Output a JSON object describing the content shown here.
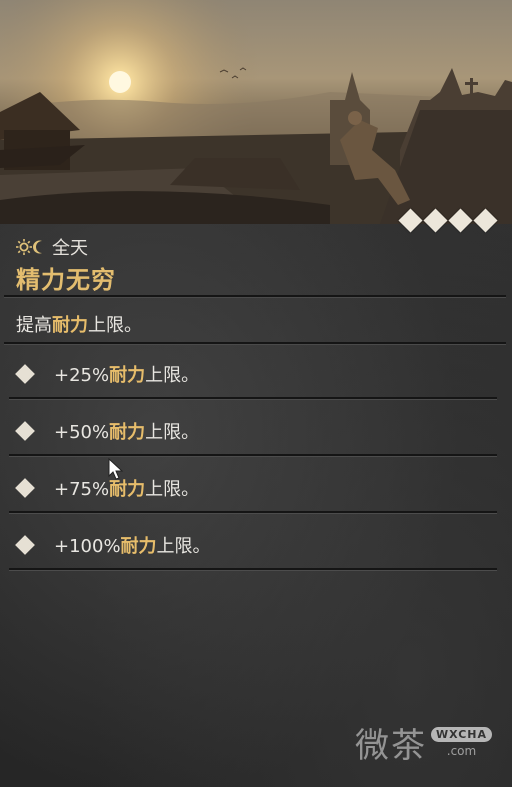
{
  "skill": {
    "time_label": "全天",
    "name": "精力无穷",
    "description_prefix": "提高",
    "description_highlight": "耐力",
    "description_suffix": "上限。",
    "rank_count": 4,
    "ranks": [
      {
        "value": "+25%",
        "highlight": "耐力",
        "suffix": "上限。"
      },
      {
        "value": "+50%",
        "highlight": "耐力",
        "suffix": "上限。"
      },
      {
        "value": "+75%",
        "highlight": "耐力",
        "suffix": "上限。"
      },
      {
        "value": "+100%",
        "highlight": "耐力",
        "suffix": "上限。"
      }
    ]
  },
  "icons": {
    "time_icon": "sun-moon-icon",
    "rank_icon": "diamond-icon"
  },
  "colors": {
    "title": "#e3bd6f",
    "highlight": "#e7bd6b",
    "text": "#e8e6e1",
    "diamond": "#ece6da"
  },
  "watermark": {
    "text": "微茶",
    "badge": "WXCHA",
    "url": ".com"
  }
}
